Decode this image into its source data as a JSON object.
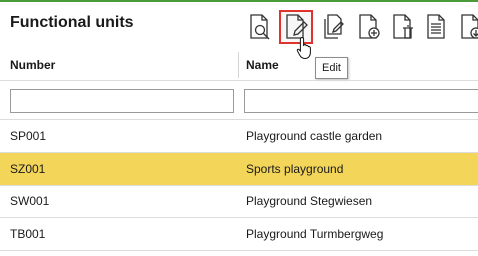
{
  "page": {
    "title": "Functional units"
  },
  "toolbar": {
    "buttons": [
      {
        "icon": "document-search-icon",
        "name": "view"
      },
      {
        "icon": "document-edit-icon",
        "name": "edit",
        "active": true
      },
      {
        "icon": "document-copy-icon",
        "name": "copy"
      },
      {
        "icon": "document-add-icon",
        "name": "add"
      },
      {
        "icon": "document-delete-icon",
        "name": "delete"
      },
      {
        "icon": "document-list-icon",
        "name": "list"
      },
      {
        "icon": "document-download-icon",
        "name": "download"
      }
    ],
    "tooltip": "Edit"
  },
  "table": {
    "columns": [
      "Number",
      "Name"
    ],
    "filters": {
      "number": "",
      "name": ""
    },
    "rows": [
      {
        "number": "SP001",
        "name": "Playground castle garden",
        "selected": false
      },
      {
        "number": "SZ001",
        "name": "Sports playground",
        "selected": true
      },
      {
        "number": "SW001",
        "name": "Playground Stegwiesen",
        "selected": false
      },
      {
        "number": "TB001",
        "name": "Playground Turmbergweg",
        "selected": false
      }
    ]
  },
  "colors": {
    "accent_line": "#4a9a3a",
    "selected_row": "#f3d55a",
    "active_border": "#e0332e"
  }
}
